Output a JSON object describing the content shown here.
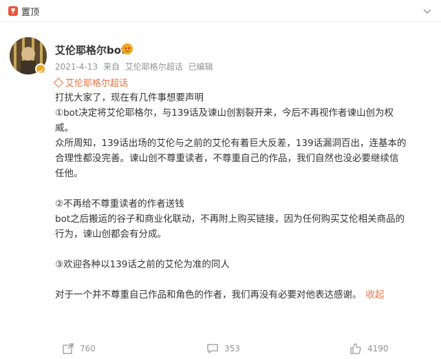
{
  "header": {
    "pin_label": "置顶"
  },
  "post": {
    "username": "艾伦耶格尔bot",
    "date": "2021-4-13",
    "source_prefix": "来自",
    "source": "艾伦耶格尔超话",
    "edited": "已编辑",
    "topic": "艾伦耶格尔超话",
    "lines": [
      "打扰大家了，现在有几件事想要声明",
      "①bot决定将艾伦耶格尔，与139话及谏山创割裂开来，今后不再视作者谏山创为权",
      "威。",
      "众所周知，139话出场的艾伦与之前的艾伦有着巨大反差，139话漏洞百出，连基本的",
      "合理性都没完善。谏山创不尊重读者，不尊重自己的作品，我们自然也没必要继续信",
      "任他。",
      "",
      "②不再给不尊重读者的作者送钱",
      "bot之后搬运的谷子和商业化联动，不再附上购买链接，因为任何购买艾伦相关商品的",
      "行为，谏山创都会有分成。",
      "",
      "③欢迎各种以139话之前的艾伦为准的同人",
      "",
      "对于一个并不尊重自己作品和角色的作者，我们再没有必要对他表达感谢。"
    ],
    "collapse_label": "收起"
  },
  "actions": {
    "repost_count": "760",
    "comment_count": "353",
    "like_count": "4190"
  },
  "colors": {
    "accent": "#eb7340",
    "pin": "#e8553e",
    "meta": "#939393"
  }
}
